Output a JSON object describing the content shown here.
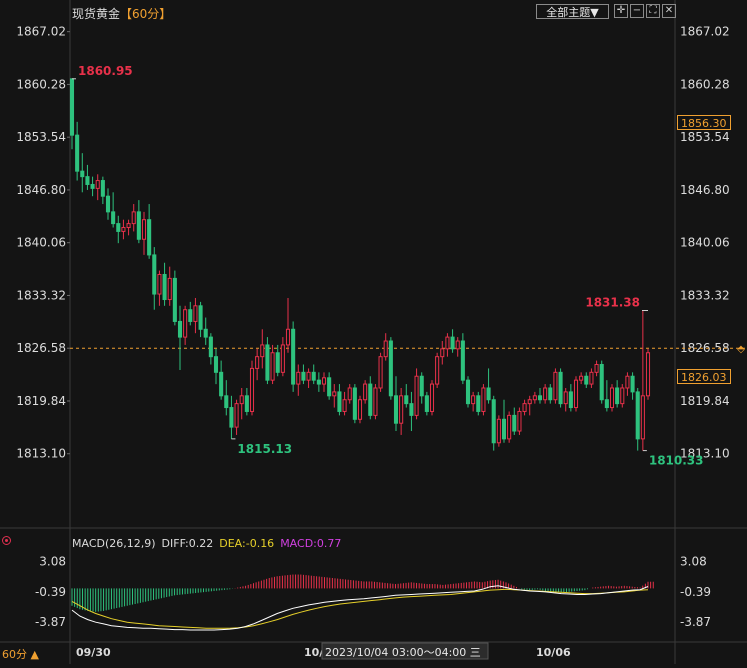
{
  "header": {
    "instrument": "现货黄金",
    "timeframe": "【60分】",
    "theme_button": "全部主题▼"
  },
  "toolbar_icons": [
    "crosshair-icon",
    "minus-icon",
    "fullscreen-icon",
    "close-icon"
  ],
  "corner": {
    "timeframe_label": "60分 ▲"
  },
  "colors": {
    "up": "#e8314a",
    "down": "#2ec27e",
    "diff": "#ffffff",
    "dea": "#e6d02a",
    "macd": "#d040e0",
    "ref_line": "#f0a030",
    "text": "#dcdcdc"
  },
  "indicator": {
    "name": "MACD(26,12,9)",
    "diff_label": "DIFF:0.22",
    "dea_label": "DEA:-0.16",
    "macd_label": "MACD:0.77"
  },
  "markers": {
    "max_label": "1860.95",
    "min_label": "1815.13",
    "max2_label": "1831.38",
    "min2_label": "1810.33",
    "ref_price_label": "1856.30",
    "last_price_label": "1826.03"
  },
  "chart_data": {
    "type": "candlestick",
    "title": "现货黄金【60分】",
    "y_range": [
      1810.0,
      1868.0
    ],
    "y_ticks": [
      "1867.02",
      "1860.28",
      "1853.54",
      "1846.80",
      "1840.06",
      "1833.32",
      "1826.58",
      "1819.84",
      "1813.10"
    ],
    "x_labels": [
      "09/30",
      "10/",
      "2023/10/04 03:00～04:00 三",
      "10/06"
    ],
    "ref_price": 1856.3,
    "last_price": 1826.03,
    "cursor_price": 1826.58,
    "candles": [
      [
        1861.0,
        1861.0,
        1852.0,
        1853.8
      ],
      [
        1853.8,
        1855.5,
        1848.0,
        1849.2
      ],
      [
        1849.2,
        1851.5,
        1846.5,
        1848.5
      ],
      [
        1848.5,
        1850.0,
        1846.8,
        1847.5
      ],
      [
        1847.5,
        1848.5,
        1846.0,
        1847.0
      ],
      [
        1847.0,
        1848.8,
        1845.5,
        1848.0
      ],
      [
        1848.0,
        1848.5,
        1845.0,
        1846.0
      ],
      [
        1846.0,
        1847.0,
        1843.0,
        1844.0
      ],
      [
        1844.0,
        1846.5,
        1842.0,
        1842.5
      ],
      [
        1842.5,
        1843.5,
        1840.0,
        1841.5
      ],
      [
        1841.5,
        1843.0,
        1840.5,
        1842.0
      ],
      [
        1842.0,
        1843.0,
        1841.0,
        1842.5
      ],
      [
        1842.5,
        1845.0,
        1841.5,
        1844.0
      ],
      [
        1844.0,
        1845.5,
        1840.0,
        1840.5
      ],
      [
        1840.5,
        1844.0,
        1838.5,
        1843.0
      ],
      [
        1843.0,
        1845.0,
        1838.0,
        1838.5
      ],
      [
        1838.5,
        1839.5,
        1831.5,
        1833.5
      ],
      [
        1833.5,
        1836.5,
        1832.0,
        1836.0
      ],
      [
        1836.0,
        1837.5,
        1832.0,
        1832.8
      ],
      [
        1832.8,
        1837.0,
        1832.0,
        1835.5
      ],
      [
        1835.5,
        1836.5,
        1829.5,
        1830.0
      ],
      [
        1830.0,
        1832.0,
        1823.8,
        1828.0
      ],
      [
        1828.0,
        1832.0,
        1827.0,
        1831.5
      ],
      [
        1831.5,
        1832.5,
        1829.5,
        1830.0
      ],
      [
        1830.0,
        1833.0,
        1828.5,
        1832.0
      ],
      [
        1832.0,
        1832.5,
        1828.0,
        1829.0
      ],
      [
        1829.0,
        1830.5,
        1827.0,
        1828.0
      ],
      [
        1828.0,
        1828.5,
        1824.5,
        1825.5
      ],
      [
        1825.5,
        1826.5,
        1822.0,
        1823.5
      ],
      [
        1823.5,
        1825.0,
        1820.0,
        1820.5
      ],
      [
        1820.5,
        1822.5,
        1818.0,
        1819.0
      ],
      [
        1819.0,
        1820.5,
        1815.0,
        1816.5
      ],
      [
        1816.5,
        1820.0,
        1815.5,
        1819.5
      ],
      [
        1819.5,
        1821.5,
        1817.5,
        1820.5
      ],
      [
        1820.5,
        1821.5,
        1818.0,
        1818.5
      ],
      [
        1818.5,
        1825.0,
        1818.0,
        1824.0
      ],
      [
        1824.0,
        1826.5,
        1822.5,
        1825.5
      ],
      [
        1825.5,
        1829.0,
        1824.0,
        1827.0
      ],
      [
        1827.0,
        1828.0,
        1822.0,
        1822.5
      ],
      [
        1822.5,
        1827.0,
        1822.0,
        1826.0
      ],
      [
        1826.0,
        1827.0,
        1823.0,
        1823.5
      ],
      [
        1823.5,
        1828.0,
        1823.0,
        1827.0
      ],
      [
        1827.0,
        1833.0,
        1826.0,
        1829.0
      ],
      [
        1829.0,
        1830.0,
        1821.0,
        1822.0
      ],
      [
        1822.0,
        1824.5,
        1820.5,
        1823.5
      ],
      [
        1823.5,
        1824.5,
        1822.0,
        1822.5
      ],
      [
        1822.5,
        1824.0,
        1821.5,
        1823.5
      ],
      [
        1823.5,
        1824.5,
        1822.0,
        1822.5
      ],
      [
        1822.5,
        1823.5,
        1821.0,
        1822.0
      ],
      [
        1822.0,
        1823.5,
        1821.0,
        1822.8
      ],
      [
        1822.8,
        1823.5,
        1820.0,
        1820.5
      ],
      [
        1820.5,
        1822.0,
        1819.0,
        1821.0
      ],
      [
        1821.0,
        1822.0,
        1818.0,
        1818.5
      ],
      [
        1818.5,
        1821.0,
        1818.0,
        1820.0
      ],
      [
        1820.0,
        1822.0,
        1819.5,
        1821.5
      ],
      [
        1821.5,
        1822.0,
        1817.0,
        1817.5
      ],
      [
        1817.5,
        1820.5,
        1817.0,
        1820.0
      ],
      [
        1820.0,
        1822.5,
        1819.5,
        1822.0
      ],
      [
        1822.0,
        1823.0,
        1817.5,
        1818.0
      ],
      [
        1818.0,
        1822.0,
        1817.5,
        1821.5
      ],
      [
        1821.5,
        1826.0,
        1821.0,
        1825.5
      ],
      [
        1825.5,
        1828.5,
        1825.0,
        1827.5
      ],
      [
        1827.5,
        1828.0,
        1820.0,
        1820.5
      ],
      [
        1820.5,
        1823.0,
        1816.0,
        1817.0
      ],
      [
        1817.0,
        1821.5,
        1815.5,
        1820.5
      ],
      [
        1820.5,
        1822.0,
        1819.0,
        1819.5
      ],
      [
        1819.5,
        1821.0,
        1816.0,
        1818.0
      ],
      [
        1818.0,
        1824.0,
        1817.5,
        1823.0
      ],
      [
        1823.0,
        1823.5,
        1819.5,
        1820.5
      ],
      [
        1820.5,
        1821.0,
        1818.0,
        1818.5
      ],
      [
        1818.5,
        1822.5,
        1818.0,
        1822.0
      ],
      [
        1822.0,
        1826.0,
        1821.5,
        1825.5
      ],
      [
        1825.5,
        1827.5,
        1824.5,
        1826.5
      ],
      [
        1826.5,
        1828.5,
        1825.5,
        1828.0
      ],
      [
        1828.0,
        1829.0,
        1826.0,
        1826.5
      ],
      [
        1826.5,
        1828.0,
        1825.5,
        1827.5
      ],
      [
        1827.5,
        1828.5,
        1822.0,
        1822.5
      ],
      [
        1822.5,
        1823.0,
        1819.0,
        1819.5
      ],
      [
        1819.5,
        1821.0,
        1818.5,
        1820.5
      ],
      [
        1820.5,
        1821.0,
        1818.0,
        1818.5
      ],
      [
        1818.5,
        1822.0,
        1818.0,
        1821.5
      ],
      [
        1821.5,
        1824.0,
        1819.5,
        1820.0
      ],
      [
        1820.0,
        1820.5,
        1813.5,
        1814.5
      ],
      [
        1814.5,
        1818.0,
        1814.0,
        1817.5
      ],
      [
        1817.5,
        1820.0,
        1814.5,
        1815.0
      ],
      [
        1815.0,
        1818.5,
        1814.5,
        1818.0
      ],
      [
        1818.0,
        1819.0,
        1815.5,
        1816.0
      ],
      [
        1816.0,
        1819.0,
        1815.5,
        1818.5
      ],
      [
        1818.5,
        1820.0,
        1818.0,
        1819.5
      ],
      [
        1819.5,
        1820.5,
        1818.0,
        1820.0
      ],
      [
        1820.0,
        1821.0,
        1819.5,
        1820.5
      ],
      [
        1820.5,
        1821.5,
        1819.5,
        1820.0
      ],
      [
        1820.0,
        1822.0,
        1819.5,
        1821.5
      ],
      [
        1821.5,
        1822.0,
        1819.5,
        1820.0
      ],
      [
        1820.0,
        1824.0,
        1819.5,
        1823.5
      ],
      [
        1823.5,
        1824.0,
        1819.0,
        1819.5
      ],
      [
        1819.5,
        1821.5,
        1818.5,
        1821.0
      ],
      [
        1821.0,
        1822.0,
        1818.5,
        1819.0
      ],
      [
        1819.0,
        1823.0,
        1818.5,
        1822.5
      ],
      [
        1822.5,
        1823.5,
        1822.0,
        1823.0
      ],
      [
        1823.0,
        1823.5,
        1821.5,
        1822.0
      ],
      [
        1822.0,
        1824.0,
        1821.5,
        1823.5
      ],
      [
        1823.5,
        1825.0,
        1823.0,
        1824.5
      ],
      [
        1824.5,
        1825.0,
        1819.5,
        1820.0
      ],
      [
        1820.0,
        1822.5,
        1818.5,
        1819.0
      ],
      [
        1819.0,
        1822.0,
        1818.5,
        1821.5
      ],
      [
        1821.5,
        1822.5,
        1819.0,
        1819.5
      ],
      [
        1819.5,
        1822.0,
        1819.0,
        1821.5
      ],
      [
        1821.5,
        1823.5,
        1820.5,
        1823.0
      ],
      [
        1823.0,
        1823.5,
        1820.0,
        1821.0
      ],
      [
        1821.0,
        1821.5,
        1813.5,
        1815.0
      ],
      [
        1815.0,
        1831.4,
        1813.5,
        1820.5
      ],
      [
        1820.5,
        1826.5,
        1820.0,
        1826.0
      ]
    ],
    "macd": {
      "y_range": [
        -4.8,
        4.2
      ],
      "y_ticks": [
        "3.08",
        "-0.39",
        "-3.87"
      ],
      "diff": [
        -2.5,
        -3.2,
        -3.6,
        -3.9,
        -4.1,
        -4.3,
        -4.4,
        -4.5,
        -4.55,
        -4.6,
        -4.6,
        -4.65,
        -4.7,
        -4.75,
        -4.75,
        -4.8,
        -4.8,
        -4.8,
        -4.8,
        -4.75,
        -4.7,
        -4.6,
        -4.4,
        -4.1,
        -3.7,
        -3.3,
        -2.9,
        -2.6,
        -2.3,
        -2.1,
        -1.9,
        -1.75,
        -1.6,
        -1.5,
        -1.4,
        -1.3,
        -1.25,
        -1.2,
        -1.1,
        -1.0,
        -0.9,
        -0.8,
        -0.75,
        -0.7,
        -0.65,
        -0.6,
        -0.55,
        -0.5,
        -0.45,
        -0.4,
        -0.35,
        -0.3,
        -0.1,
        0.2,
        0.3,
        0.1,
        -0.1,
        -0.2,
        -0.3,
        -0.35,
        -0.4,
        -0.5,
        -0.6,
        -0.65,
        -0.7,
        -0.7,
        -0.65,
        -0.6,
        -0.5,
        -0.4,
        -0.3,
        -0.2,
        -0.15,
        0.22
      ],
      "dea": [
        -1.5,
        -2.0,
        -2.5,
        -2.9,
        -3.2,
        -3.5,
        -3.7,
        -3.9,
        -4.0,
        -4.1,
        -4.2,
        -4.3,
        -4.35,
        -4.4,
        -4.45,
        -4.5,
        -4.55,
        -4.6,
        -4.6,
        -4.6,
        -4.6,
        -4.55,
        -4.45,
        -4.3,
        -4.1,
        -3.85,
        -3.6,
        -3.3,
        -3.0,
        -2.75,
        -2.5,
        -2.3,
        -2.1,
        -1.95,
        -1.8,
        -1.7,
        -1.6,
        -1.5,
        -1.4,
        -1.3,
        -1.2,
        -1.1,
        -1.0,
        -0.95,
        -0.9,
        -0.85,
        -0.8,
        -0.75,
        -0.7,
        -0.6,
        -0.5,
        -0.4,
        -0.3,
        -0.2,
        -0.15,
        -0.1,
        -0.15,
        -0.2,
        -0.25,
        -0.3,
        -0.35,
        -0.4,
        -0.45,
        -0.5,
        -0.55,
        -0.6,
        -0.6,
        -0.55,
        -0.5,
        -0.45,
        -0.4,
        -0.3,
        -0.2,
        -0.16
      ],
      "hist": [
        -2.0,
        -2.4,
        -2.6,
        -2.7,
        -2.6,
        -2.4,
        -2.2,
        -2.0,
        -1.8,
        -1.6,
        -1.4,
        -1.2,
        -1.0,
        -0.8,
        -0.7,
        -0.6,
        -0.5,
        -0.4,
        -0.3,
        -0.2,
        -0.1,
        0.1,
        0.3,
        0.6,
        0.9,
        1.2,
        1.4,
        1.5,
        1.6,
        1.6,
        1.5,
        1.4,
        1.3,
        1.2,
        1.1,
        1.0,
        0.9,
        0.8,
        0.8,
        0.7,
        0.6,
        0.5,
        0.6,
        0.7,
        0.6,
        0.5,
        0.5,
        0.4,
        0.5,
        0.6,
        0.7,
        0.8,
        0.7,
        0.9,
        1.0,
        0.7,
        0.3,
        -0.1,
        -0.2,
        -0.1,
        -0.3,
        -0.4,
        -0.5,
        -0.4,
        -0.3,
        -0.2,
        0.1,
        0.2,
        0.3,
        0.2,
        0.3,
        0.2,
        0.1,
        0.77
      ]
    }
  }
}
